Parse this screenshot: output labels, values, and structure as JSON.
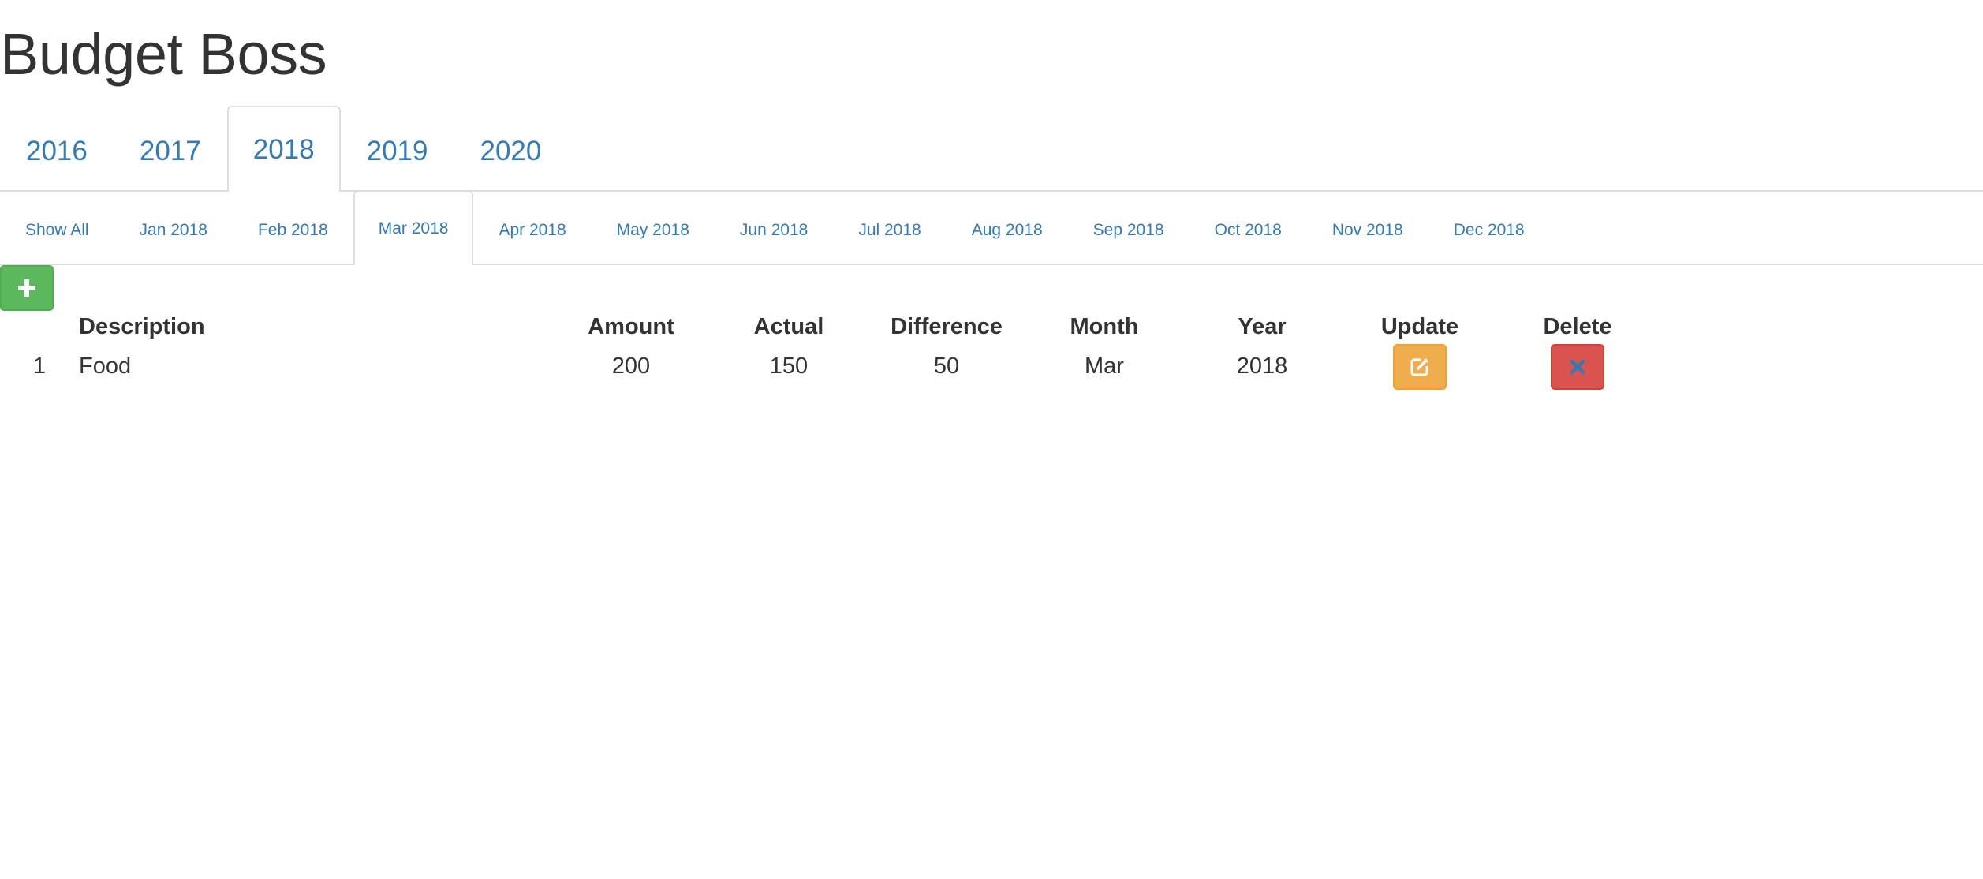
{
  "app": {
    "title": "Budget Boss"
  },
  "year_tabs": [
    {
      "label": "2016",
      "active": false
    },
    {
      "label": "2017",
      "active": false
    },
    {
      "label": "2018",
      "active": true
    },
    {
      "label": "2019",
      "active": false
    },
    {
      "label": "2020",
      "active": false
    }
  ],
  "month_tabs": [
    {
      "label": "Show All",
      "active": false
    },
    {
      "label": "Jan 2018",
      "active": false
    },
    {
      "label": "Feb 2018",
      "active": false
    },
    {
      "label": "Mar 2018",
      "active": true
    },
    {
      "label": "Apr 2018",
      "active": false
    },
    {
      "label": "May 2018",
      "active": false
    },
    {
      "label": "Jun 2018",
      "active": false
    },
    {
      "label": "Jul 2018",
      "active": false
    },
    {
      "label": "Aug 2018",
      "active": false
    },
    {
      "label": "Sep 2018",
      "active": false
    },
    {
      "label": "Oct 2018",
      "active": false
    },
    {
      "label": "Nov 2018",
      "active": false
    },
    {
      "label": "Dec 2018",
      "active": false
    }
  ],
  "add_button": {
    "icon": "plus-icon"
  },
  "table": {
    "headers": {
      "description": "Description",
      "amount": "Amount",
      "actual": "Actual",
      "difference": "Difference",
      "month": "Month",
      "year": "Year",
      "update": "Update",
      "delete": "Delete"
    },
    "rows": [
      {
        "index": "1",
        "description": "Food",
        "amount": "200",
        "actual": "150",
        "difference": "50",
        "month": "Mar",
        "year": "2018",
        "update_icon": "edit-icon",
        "delete_icon": "close-icon"
      }
    ]
  },
  "colors": {
    "link": "#337ab7",
    "success": "#5cb85c",
    "warning": "#f0ad4e",
    "danger": "#d9534f",
    "delete_icon": "#337ab7"
  }
}
